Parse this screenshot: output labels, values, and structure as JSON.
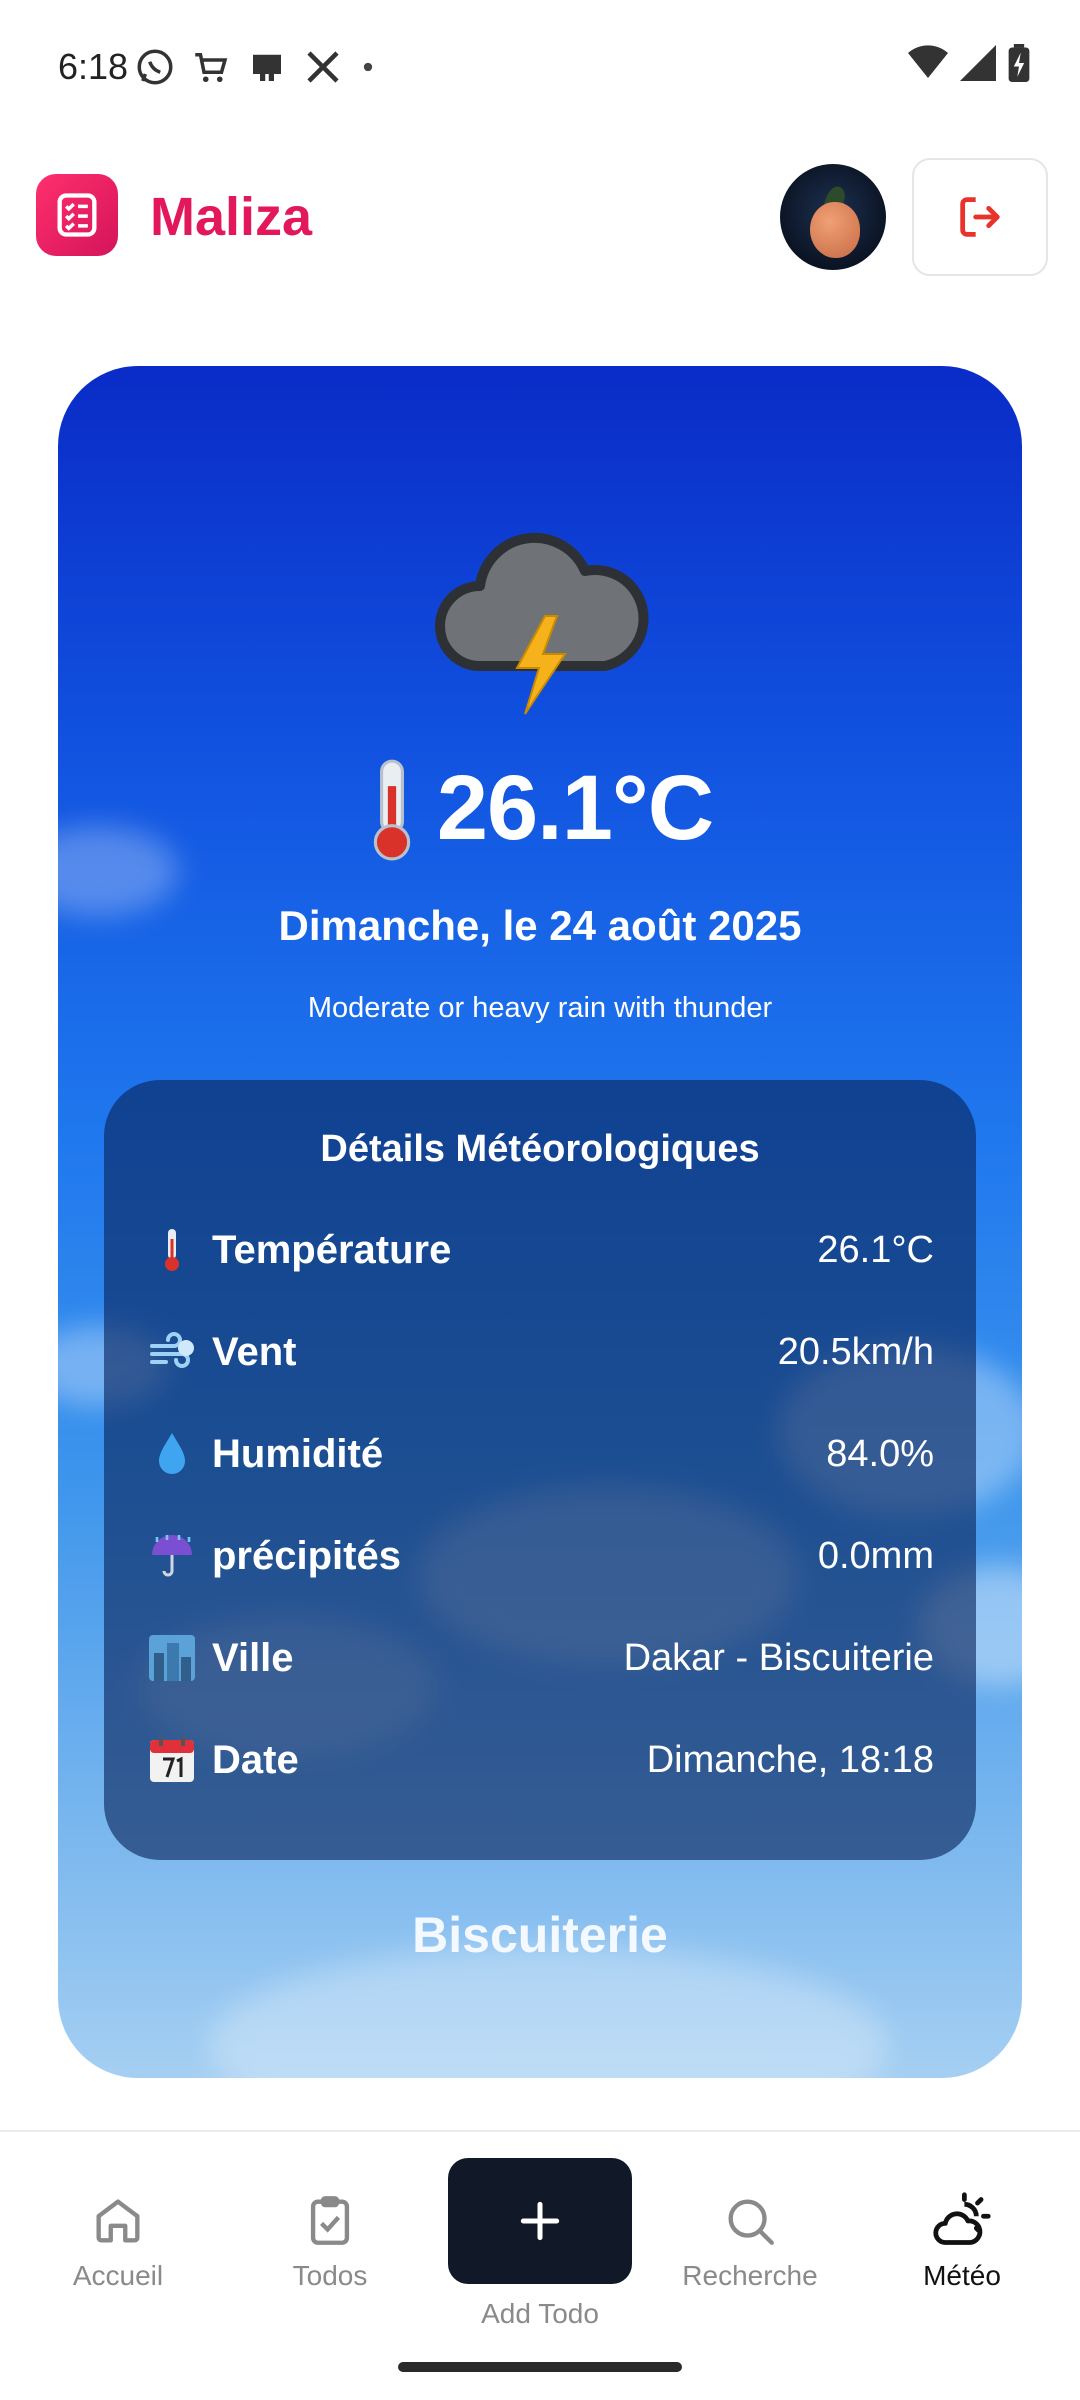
{
  "status_bar": {
    "time": "6:18",
    "notification_icons": [
      "whatsapp-icon",
      "shopping-cart-icon",
      "app-icon",
      "x-icon",
      "dot-icon"
    ],
    "right_icons": [
      "wifi-icon",
      "signal-icon",
      "battery-icon"
    ]
  },
  "header": {
    "app_name": "Maliza",
    "logo_icon": "todo-list-icon",
    "logout_icon": "logout-icon",
    "brand_color": "#e2185b"
  },
  "weather": {
    "condition_icon": "thunder-cloud-icon",
    "temperature": "26.1°C",
    "date": "Dimanche, le 24 août 2025",
    "condition": "Moderate or heavy rain with thunder",
    "details": {
      "title": "Détails Météorologiques",
      "rows": [
        {
          "icon": "thermometer-icon",
          "label": "Température",
          "value": "26.1°C"
        },
        {
          "icon": "wind-icon",
          "label": "Vent",
          "value": "20.5km/h"
        },
        {
          "icon": "droplet-icon",
          "label": "Humidité",
          "value": "84.0%"
        },
        {
          "icon": "umbrella-rain-icon",
          "label": "précipités",
          "value": "0.0mm"
        },
        {
          "icon": "city-icon",
          "label": "Ville",
          "value": "Dakar - Biscuiterie"
        },
        {
          "icon": "calendar-icon",
          "label": "Date",
          "value": "Dimanche, 18:18"
        }
      ]
    },
    "city": "Biscuiterie"
  },
  "nav": {
    "items": [
      {
        "label": "Accueil",
        "icon": "home-icon",
        "active": false
      },
      {
        "label": "Todos",
        "icon": "clipboard-check-icon",
        "active": false
      },
      {
        "label": "Add Todo",
        "icon": "plus-icon",
        "active": false
      },
      {
        "label": "Recherche",
        "icon": "search-icon",
        "active": false
      },
      {
        "label": "Météo",
        "icon": "weather-icon",
        "active": true
      }
    ]
  }
}
